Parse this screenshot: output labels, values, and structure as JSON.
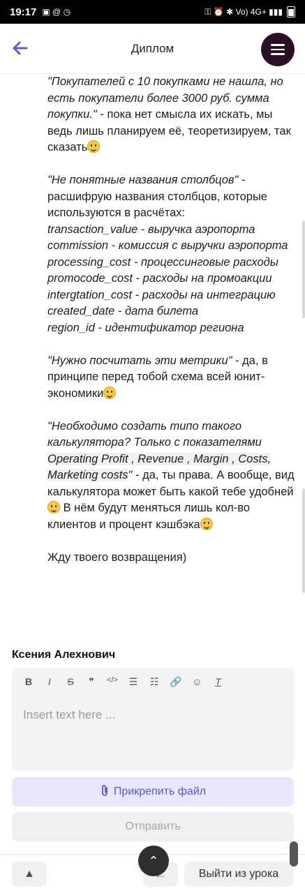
{
  "status_bar": {
    "time": "19:17",
    "left_icons": "▣ @ ◷",
    "right_icons": "⚿ ⏰ ✱ Vo) 4G+ ▮▮▮"
  },
  "header": {
    "title": "Диплом"
  },
  "message": {
    "p1_quote": "\"Покупателей с 10 покупками не нашла, но есть покупатели более 3000 руб. сумма покупки.\"",
    "p1_text": " - пока нет смысла их искать, мы ведь лишь планируем её, теоретизируем, так сказать",
    "p2_quote": "\"Не понятные названия столбцов\"",
    "p2_text": " - расшифрую названия столбцов, которые используются в расчётах:",
    "columns": [
      "transaction_value - выручка аэропорта",
      "commission - комиссия с выручки аэропорта",
      "processing_cost - процессинговые расходы",
      "promocode_cost - расходы на промоакции",
      "intergtation_cost - расходы на интеграцию",
      "created_date - дата билета",
      "region_id - идентификатор региона"
    ],
    "p3_quote": "\"Нужно посчитать  эти метрики\"",
    "p3_text": " - да, в принципе перед тобой схема всей юнит-экономики",
    "p4_quote_a": "\"Необходимо создать типо такого калькулятора? Только с показателями ",
    "p4_quote_b": "Operating Profit , Revenue , Margin , Costs, Marketing costs",
    "p4_quote_c": "\"",
    "p4_text_a": " - да, ты права. А вообще, вид калькулятора может быть какой тебе удобней",
    "p4_text_b": " В нём будут меняться лишь кол-во клиентов и процент кэшбэка",
    "p5": "Жду твоего возвращения)"
  },
  "reply": {
    "author": "Ксения Алехнович",
    "toolbar": [
      "B",
      "I",
      "S",
      "❞",
      "</>",
      "☰",
      "☷",
      "🔗",
      "☺",
      "T"
    ],
    "placeholder": "Insert text here ...",
    "attach_label": "Прикрепить файл",
    "send_label": "Отправить"
  },
  "bottom": {
    "exit_label": "Выйти из урока",
    "warn_icon": "▲",
    "prev_icon": "←",
    "up_icon": "⌃"
  }
}
